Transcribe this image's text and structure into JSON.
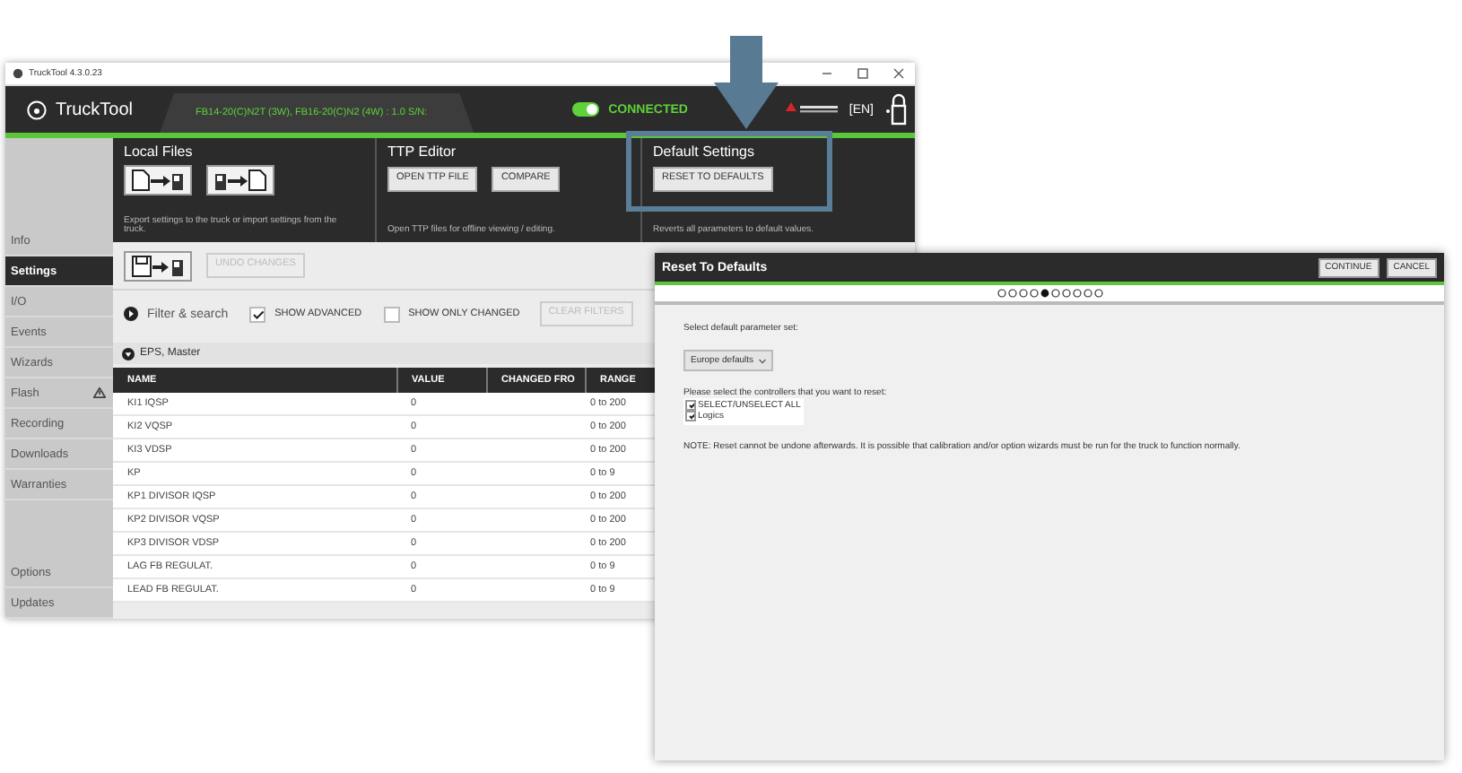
{
  "window": {
    "title": "TruckTool 4.3.0.23",
    "app_name": "TruckTool",
    "model_tab": "FB14-20(C)N2T (3W), FB16-20(C)N2 (4W) : 1.0  S/N:",
    "connection": {
      "on": true,
      "label": "CONNECTED"
    },
    "language": "[EN]"
  },
  "toolbar": [
    {
      "kind": "local",
      "title": "Local Files",
      "description": "Export settings to the truck or import settings from the truck.",
      "highlighted": false
    },
    {
      "kind": "ttp",
      "title": "TTP Editor",
      "buttons": [
        "OPEN TTP FILE",
        "COMPARE"
      ],
      "description": "Open TTP files for offline viewing / editing.",
      "highlighted": false
    },
    {
      "kind": "defaults",
      "title": "Default Settings",
      "buttons": [
        "RESET TO DEFAULTS"
      ],
      "description": "Reverts all parameters to default values.",
      "highlighted": true
    }
  ],
  "sidebar": {
    "items": [
      {
        "label": "Info",
        "selected": false,
        "alert": false
      },
      {
        "label": "Settings",
        "selected": true,
        "alert": false
      },
      {
        "label": "I/O",
        "selected": false,
        "alert": false
      },
      {
        "label": "Events",
        "selected": false,
        "alert": false
      },
      {
        "label": "Wizards",
        "selected": false,
        "alert": false
      },
      {
        "label": "Flash",
        "selected": false,
        "alert": true
      },
      {
        "label": "Recording",
        "selected": false,
        "alert": false
      },
      {
        "label": "Downloads",
        "selected": false,
        "alert": false
      },
      {
        "label": "Warranties",
        "selected": false,
        "alert": false
      }
    ],
    "bottom_items": [
      {
        "label": "Options",
        "selected": false,
        "alert": false
      },
      {
        "label": "Updates",
        "selected": false,
        "alert": false
      }
    ]
  },
  "content": {
    "undo": {
      "label": "UNDO CHANGES",
      "disabled": true
    },
    "filter": {
      "label": "Filter & search",
      "expanded": false
    },
    "options": [
      {
        "label": "SHOW ADVANCED",
        "checked": true
      },
      {
        "label": "SHOW ONLY CHANGED",
        "checked": false
      }
    ],
    "clear_filters": {
      "label": "CLEAR FILTERS",
      "disabled": true
    },
    "group": {
      "label": "EPS, Master",
      "expanded": true
    },
    "table": {
      "columns": [
        "NAME",
        "VALUE",
        "CHANGED FRO",
        "RANGE"
      ],
      "rows": [
        {
          "name": "KI1  IQSP",
          "value": "0",
          "range": "0 to 200"
        },
        {
          "name": "KI2  VQSP",
          "value": "0",
          "range": "0 to 200"
        },
        {
          "name": "KI3  VDSP",
          "value": "0",
          "range": "0 to 200"
        },
        {
          "name": "KP",
          "value": "0",
          "range": "0 to 9"
        },
        {
          "name": "KP1 DIVISOR IQSP",
          "value": "0",
          "range": "0 to 200"
        },
        {
          "name": "KP2 DIVISOR VQSP",
          "value": "0",
          "range": "0 to 200"
        },
        {
          "name": "KP3 DIVISOR VDSP",
          "value": "0",
          "range": "0 to 200"
        },
        {
          "name": "LAG FB REGULAT.",
          "value": "0",
          "range": "0 to 9"
        },
        {
          "name": "LEAD FB REGULAT.",
          "value": "0",
          "range": "0 to 9"
        }
      ]
    }
  },
  "dialog": {
    "title": "Reset To Defaults",
    "buttons": [
      "CONTINUE",
      "CANCEL"
    ],
    "steps": [
      {
        "selected": false
      },
      {
        "selected": false
      },
      {
        "selected": false
      },
      {
        "selected": false
      },
      {
        "selected": true
      },
      {
        "selected": false
      },
      {
        "selected": false
      },
      {
        "selected": false
      },
      {
        "selected": false
      },
      {
        "selected": false
      }
    ],
    "parameter_set": {
      "label": "Select default parameter set:",
      "value": "Europe defaults"
    },
    "controllers": {
      "label": "Please select the controllers that you want to reset:",
      "items": [
        {
          "label": "SELECT/UNSELECT ALL",
          "checked": true
        },
        {
          "label": "Logics",
          "checked": true
        }
      ]
    },
    "note": "NOTE: Reset cannot be undone afterwards. It is possible that calibration and/or option wizards must be run for the truck to function normally."
  }
}
